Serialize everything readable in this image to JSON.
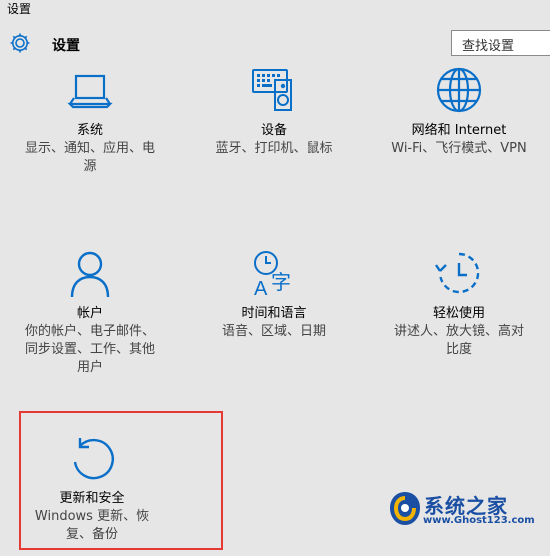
{
  "window": {
    "title": "设置"
  },
  "header": {
    "title": "设置",
    "icon": "gear-icon"
  },
  "search": {
    "placeholder": "查找设置"
  },
  "accent_color": "#0a6fc9",
  "tiles": [
    {
      "id": "system",
      "icon": "laptop-icon",
      "name": "系统",
      "desc": [
        "显示、通知、应用、电",
        "源"
      ]
    },
    {
      "id": "devices",
      "icon": "devices-icon",
      "name": "设备",
      "desc": [
        "蓝牙、打印机、鼠标"
      ]
    },
    {
      "id": "network",
      "icon": "globe-icon",
      "name": "网络和 Internet",
      "desc": [
        "Wi-Fi、飞行模式、VPN"
      ]
    },
    {
      "id": "accounts",
      "icon": "person-icon",
      "name": "帐户",
      "desc": [
        "你的帐户、电子邮件、",
        "同步设置、工作、其他",
        "用户"
      ]
    },
    {
      "id": "time-language",
      "icon": "time-language-icon",
      "name": "时间和语言",
      "desc": [
        "语音、区域、日期"
      ]
    },
    {
      "id": "ease-of-access",
      "icon": "ease-of-access-icon",
      "name": "轻松使用",
      "desc": [
        "讲述人、放大镜、高对",
        "比度"
      ]
    },
    {
      "id": "update-security",
      "icon": "refresh-icon",
      "name": "更新和安全",
      "desc": [
        "Windows 更新、恢",
        "复、备份"
      ]
    }
  ],
  "watermark": {
    "brand": "系统之家",
    "url": "www.Ghost123.com"
  }
}
